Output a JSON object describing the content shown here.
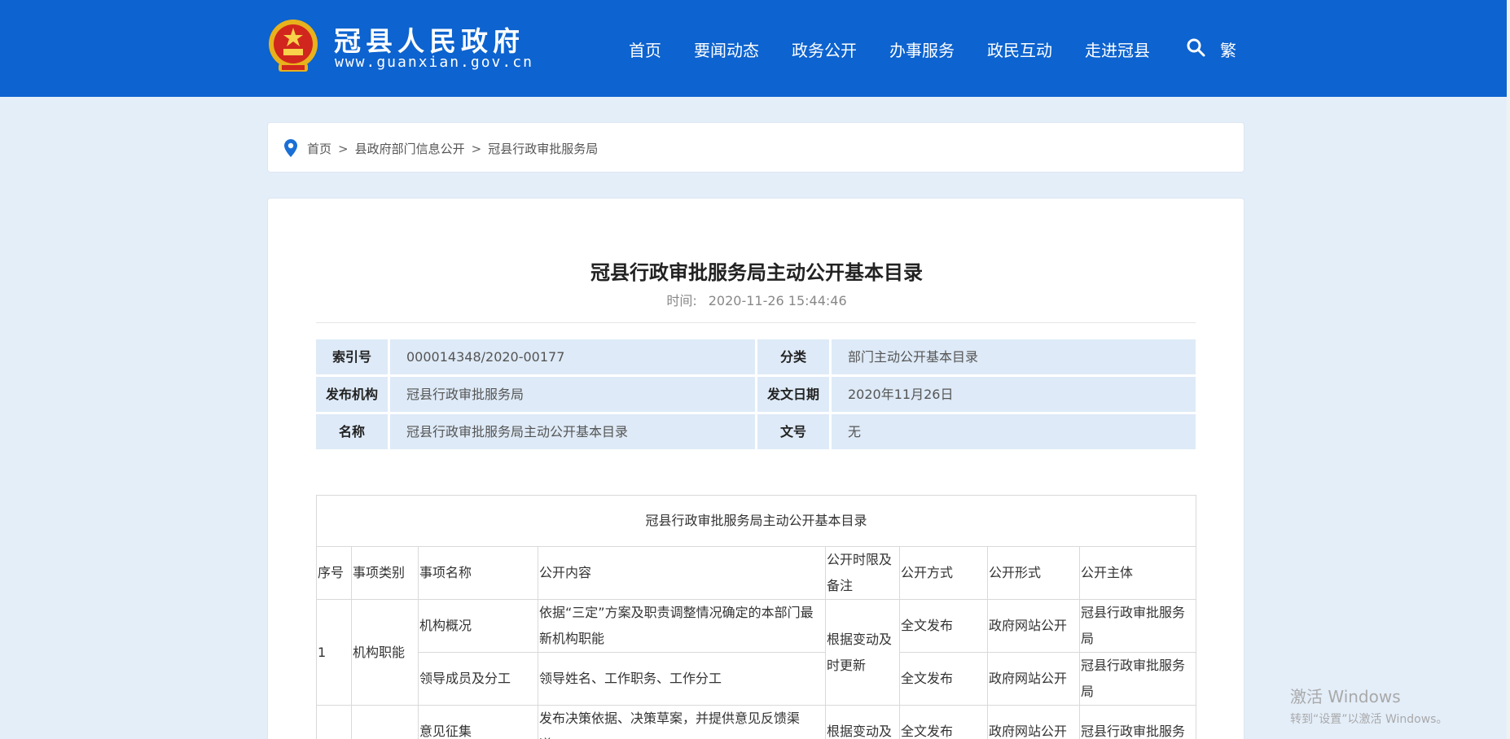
{
  "header": {
    "site_title": "冠县人民政府",
    "site_url": "www.guanxian.gov.cn",
    "nav": [
      "首页",
      "要闻动态",
      "政务公开",
      "办事服务",
      "政民互动",
      "走进冠县"
    ],
    "lang_toggle": "繁",
    "icons": {
      "emblem": "national-emblem-icon",
      "search": "search-icon"
    },
    "colors": {
      "header_bg": "#0d63cf",
      "page_bg": "#e4eef9"
    }
  },
  "breadcrumb": {
    "icon": "location-pin-icon",
    "items": [
      "首页",
      "县政府部门信息公开",
      "冠县行政审批服务局"
    ],
    "separator": ">"
  },
  "article": {
    "title": "冠县行政审批服务局主动公开基本目录",
    "time_label": "时间:",
    "time": "2020-11-26 15:44:46"
  },
  "meta": {
    "index_no_label": "索引号",
    "index_no": "000014348/2020-00177",
    "category_label": "分类",
    "category": "部门主动公开基本目录",
    "publisher_label": "发布机构",
    "publisher": "冠县行政审批服务局",
    "date_label": "发文日期",
    "date": "2020年11月26日",
    "name_label": "名称",
    "name": "冠县行政审批服务局主动公开基本目录",
    "doc_no_label": "文号",
    "doc_no": "无"
  },
  "catalog": {
    "caption": "冠县行政审批服务局主动公开基本目录",
    "headers": [
      "序号",
      "事项类别",
      "事项名称",
      "公开内容",
      "公开时限及备注",
      "公开方式",
      "公开形式",
      "公开主体"
    ],
    "group1": {
      "no": "1",
      "category": "机构职能",
      "timing": "根据变动及时更新",
      "rows": [
        {
          "name": "机构概况",
          "content": "依据“三定”方案及职责调整情况确定的本部门最新机构职能",
          "method": "全文发布",
          "form": "政府网站公开",
          "subject": "冠县行政审批服务局"
        },
        {
          "name": "领导成员及分工",
          "content": "领导姓名、工作职务、工作分工",
          "method": "全文发布",
          "form": "政府网站公开",
          "subject": "冠县行政审批服务局"
        }
      ]
    },
    "group2": {
      "name": "意见征集",
      "content": "发布决策依据、决策草案，并提供意见反馈渠道，",
      "timing": "根据变动及",
      "method": "全文发布",
      "form": "政府网站公开",
      "subject": "冠县行政审批服务"
    }
  },
  "watermark": {
    "line1": "激活 Windows",
    "line2": "转到“设置”以激活 Windows。"
  }
}
